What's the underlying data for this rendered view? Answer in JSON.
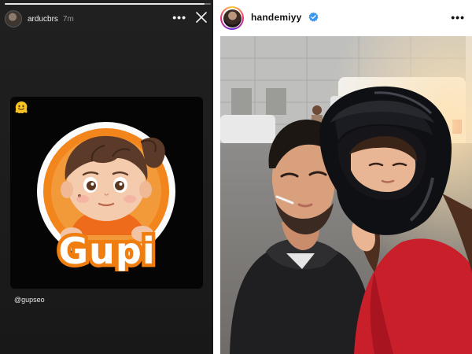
{
  "story": {
    "username": "arducbrs",
    "time_ago": "7m",
    "more_icon": "more-horizontal-icon",
    "close_icon": "close-icon",
    "progress": 0.97,
    "card_emoji": "🫠",
    "sticker_text": "Gupi",
    "mention": "@gupseo"
  },
  "post": {
    "username": "handemiyy",
    "verified": true,
    "more_icon": "more-horizontal-icon"
  },
  "colors": {
    "story_bg": "#1e1e1e",
    "verified_blue": "#3897f0",
    "gupi_orange": "#f07d10"
  }
}
